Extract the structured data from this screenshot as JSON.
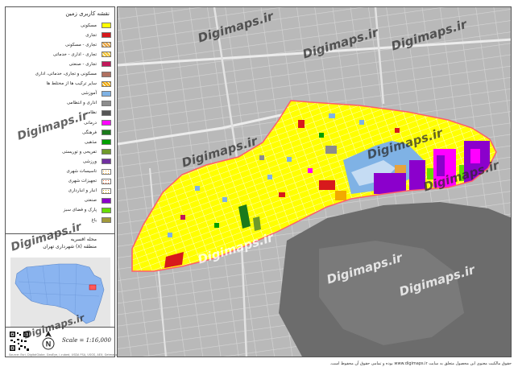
{
  "legend": {
    "title": "نقشه کاربری زمین",
    "items": [
      {
        "label": "مسکونی",
        "color": "#ffff00"
      },
      {
        "label": "تجاری",
        "color": "#d7191c"
      },
      {
        "label": "تجاری - مسکونی",
        "color": "#e8a33c",
        "pattern": "hatch"
      },
      {
        "label": "تجاری - اداری - خدماتی",
        "color": "#f2c230",
        "pattern": "hatch"
      },
      {
        "label": "تجاری - صنعتی",
        "color": "#c2185b"
      },
      {
        "label": "مسکونی و تجاری، خدماتی، اداری",
        "color": "#b07060"
      },
      {
        "label": "سایر ترکیب ها از مختلط ها",
        "color": "#f2a900",
        "pattern": "hatch"
      },
      {
        "label": "آموزشی",
        "color": "#7fb2e5"
      },
      {
        "label": "اداری و انتظامی",
        "color": "#8c8c8c"
      },
      {
        "label": "نظامی",
        "color": "#555555"
      },
      {
        "label": "درمانی",
        "color": "#ff00ff"
      },
      {
        "label": "فرهنگی",
        "color": "#1b7a1b"
      },
      {
        "label": "مذهبی",
        "color": "#00a000"
      },
      {
        "label": "تفریحی و توریستی",
        "color": "#6f9a2a"
      },
      {
        "label": "ورزشی",
        "color": "#7030a0"
      },
      {
        "label": "تاسیسات شهری",
        "color": "#f5a623",
        "pattern": "dots"
      },
      {
        "label": "تجهیزات شهری",
        "color": "#e25822",
        "pattern": "dots"
      },
      {
        "label": "انبار و انبارداری",
        "color": "#c8a000",
        "pattern": "dots"
      },
      {
        "label": "صنعتی",
        "color": "#8b00cc"
      },
      {
        "label": "پارک و فضای سبز",
        "color": "#66dd00"
      },
      {
        "label": "باغ",
        "color": "#a29a3a"
      }
    ]
  },
  "locator": {
    "neighborhood": "محله افسریه",
    "district": "منطقه (۸) شهرداری تهران"
  },
  "scale_text": "Scale = 1:16,000",
  "north_label": "N",
  "credit": "Source: Esri, DigitalGlobe, GeoEye, i-cubed, USDA FSA, USGS, AEX, Getmapping, Aerogrid, IGN, IGP, swisstopo, and the GIS User Community",
  "watermark": "Digimaps.ir",
  "footer_note": "حقوق مالکیت معنوی این محصول متعلق به سایت www.digimaps.ir بوده و تمامی حقوق آن محفوظ است."
}
